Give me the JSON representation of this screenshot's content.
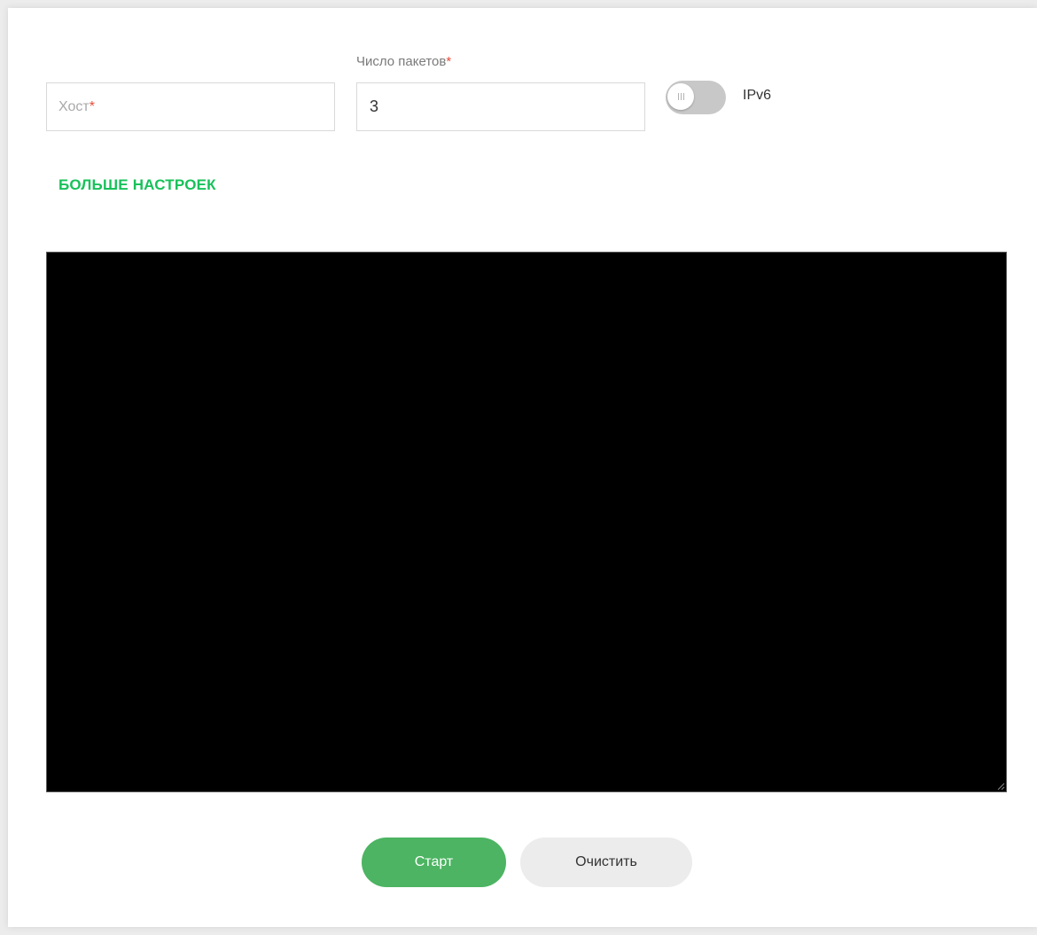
{
  "form": {
    "host": {
      "label": "Хост",
      "required_mark": "*",
      "value": ""
    },
    "packets": {
      "label": "Число пакетов",
      "required_mark": "*",
      "value": "3"
    },
    "ipv6_toggle": {
      "label": "IPv6",
      "enabled": false
    },
    "more_settings_label": "БОЛЬШЕ НАСТРОЕК"
  },
  "output": {
    "text": ""
  },
  "actions": {
    "start_label": "Старт",
    "clear_label": "Очистить"
  },
  "colors": {
    "accent_green_link": "#17c15a",
    "start_button": "#4cb462",
    "clear_button": "#ececec",
    "required_mark": "#e74c3c",
    "toggle_off": "#c8c8c8",
    "terminal_background": "#000000"
  },
  "icons": {
    "toggle_knob": "toggle-grip-icon",
    "textarea_resize": "resize-grip-icon"
  }
}
